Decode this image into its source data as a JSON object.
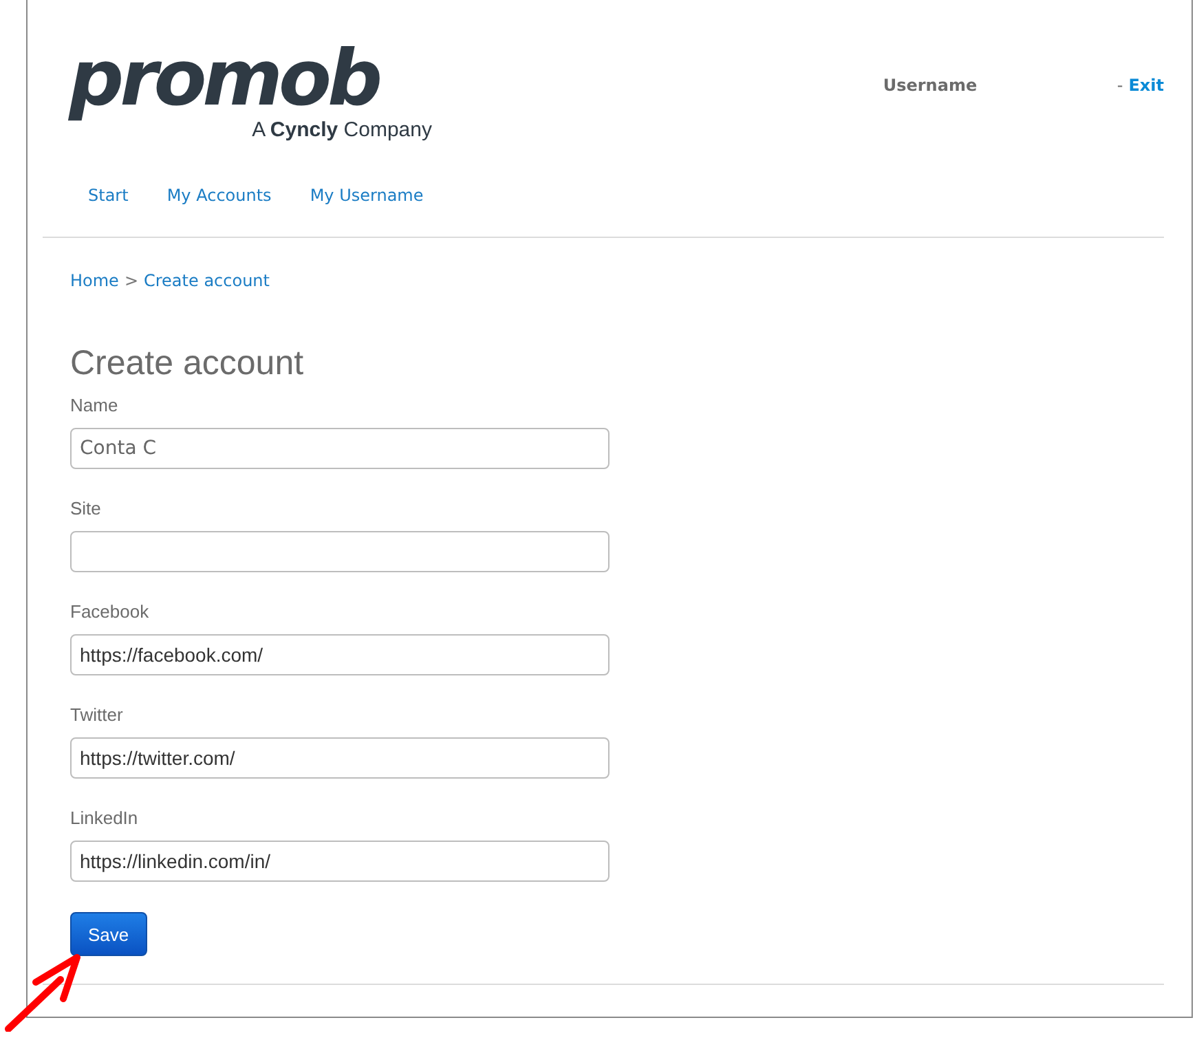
{
  "logo": {
    "wordmark": "promob",
    "tagline": "A **Cyncly** Company"
  },
  "user": {
    "name": "Username",
    "separator": "-",
    "exit": "Exit"
  },
  "nav": [
    {
      "label": "Start"
    },
    {
      "label": "My Accounts"
    },
    {
      "label": "My Username"
    }
  ],
  "breadcrumb": [
    {
      "label": "Home",
      "kind": "link"
    },
    {
      "label": ">",
      "kind": "separator"
    },
    {
      "label": "Create account",
      "kind": "link"
    }
  ],
  "form": {
    "title": "Create account",
    "fields": [
      {
        "label": "Name",
        "value": "Conta C",
        "kind": "large"
      },
      {
        "label": "Site",
        "kind": "normal"
      },
      {
        "label": "Facebook",
        "value": "https://facebook.com/",
        "kind": "normal"
      },
      {
        "label": "Twitter",
        "value": "https://twitter.com/",
        "kind": "normal"
      },
      {
        "label": "LinkedIn",
        "value": "https://linkedin.com/in/",
        "kind": "normal"
      }
    ],
    "submit": "Save"
  }
}
